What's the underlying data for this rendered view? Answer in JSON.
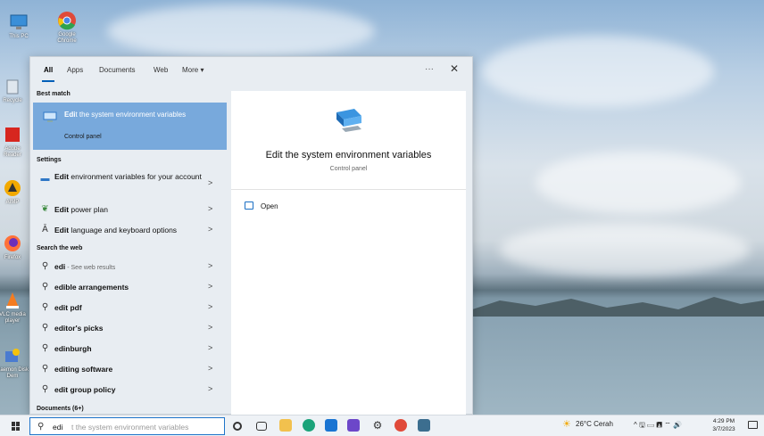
{
  "desktop": {
    "icons": [
      {
        "label": "This PC",
        "icon": "computer-icon"
      },
      {
        "label": "Google Chrome",
        "icon": "chrome-icon"
      },
      {
        "label": "Recycle",
        "icon": "recycle-bin-icon"
      },
      {
        "label": "Adobe Reader",
        "icon": "adobe-reader-icon"
      },
      {
        "label": "AIMP",
        "icon": "aimp-icon"
      },
      {
        "label": "Firefox",
        "icon": "firefox-icon"
      },
      {
        "label": "VLC media player",
        "icon": "vlc-icon"
      },
      {
        "label": "Daemon Disk Dem",
        "icon": "disk-tool-icon"
      }
    ]
  },
  "search_panel": {
    "tabs": [
      {
        "label": "All",
        "active": true
      },
      {
        "label": "Apps"
      },
      {
        "label": "Documents"
      },
      {
        "label": "Web"
      },
      {
        "label": "More ▾"
      }
    ],
    "more_options": "···",
    "close": "✕",
    "best_match_header": "Best match",
    "best_match": {
      "title_bold": "Edi",
      "title_rest": "t the system environment variables",
      "subtitle": "Control panel",
      "icon": "system-env-icon"
    },
    "settings_header": "Settings",
    "settings": [
      {
        "bold": "Edit",
        "rest": " environment variables for your account",
        "icon": "env-icon"
      },
      {
        "bold": "Edit",
        "rest": " power plan",
        "icon": "power-plan-icon"
      },
      {
        "bold": "Edit",
        "rest": " language and keyboard options",
        "icon": "language-icon"
      }
    ],
    "web_header": "Search the web",
    "web": [
      {
        "bold": "edi",
        "sub": " - See web results"
      },
      {
        "bold": "edi",
        "rest": "ble arrangements"
      },
      {
        "bold": "edi",
        "rest": "t pdf"
      },
      {
        "bold": "edi",
        "rest": "tor's picks"
      },
      {
        "bold": "edi",
        "rest": "nburgh"
      },
      {
        "bold": "edi",
        "rest": "ting software"
      },
      {
        "bold": "edi",
        "rest": "t group policy"
      }
    ],
    "documents_header": "Documents (6+)",
    "preview": {
      "title": "Edit the system environment variables",
      "subtitle": "Control panel",
      "open_label": "Open"
    }
  },
  "taskbar": {
    "search_typed": "edi",
    "search_suggestion": "t the system environment variables",
    "apps": [
      "cortana-icon",
      "task-view-icon",
      "file-explorer-icon",
      "edge-icon",
      "mail-icon",
      "editor-icon",
      "settings-icon",
      "chrome-icon",
      "app-icon"
    ],
    "weather": "26°C  Cerah",
    "tray_icons": "^ 🖫 ▭ 🖪 ⌔ 🔊",
    "time": "4:29 PM",
    "date": "3/7/2023"
  },
  "colors": {
    "accent": "#005fb8",
    "best_match_bg": "#78a9dc",
    "panel_bg": "#e8edf2"
  }
}
